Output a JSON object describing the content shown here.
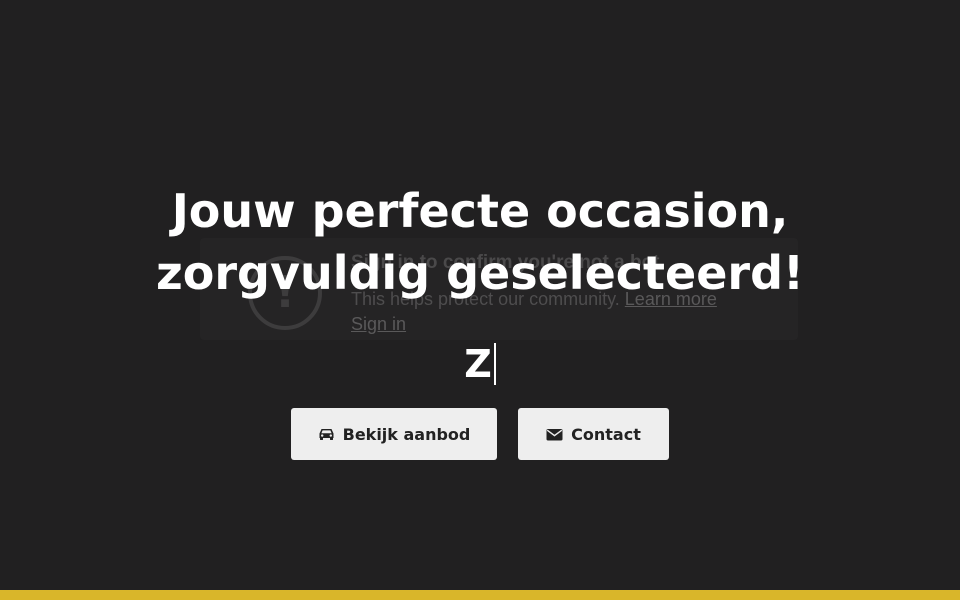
{
  "embed": {
    "icon": "exclamation-icon",
    "title": "Sign in to confirm you're not a bot",
    "text": "This helps protect our community.",
    "learn_more": "Learn more",
    "sign_in": "Sign in"
  },
  "hero": {
    "title_line1": "Jouw perfecte occasion,",
    "title_line2": "zorgvuldig geselecteerd!",
    "typed_text": "Z"
  },
  "buttons": {
    "aanbod_label": "Bekijk aanbod",
    "aanbod_icon": "car-icon",
    "contact_label": "Contact",
    "contact_icon": "envelope-icon"
  },
  "colors": {
    "background": "#212021",
    "accent": "#d9b62a",
    "button_bg": "#eeeeee",
    "text": "#ffffff"
  }
}
